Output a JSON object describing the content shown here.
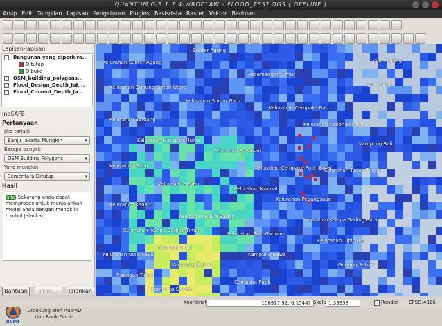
{
  "window": {
    "title": "QUANTUM GIS 1.7.4-WROCLAW - FLOOD_TEST.QGS ( OFFLINE )"
  },
  "menu": [
    "Arsip",
    "Edit",
    "Tampilan",
    "Lapisan",
    "Pengaturan",
    "Plugins",
    "Basisdata",
    "Raster",
    "Vektor",
    "Bantuan"
  ],
  "layers_panel": {
    "title": "Lapisan-lapisan",
    "layers": [
      {
        "name": "Bangunan yang diperkira..."
      },
      {
        "name": "Ditutup",
        "legend": true,
        "color": "#cc2222"
      },
      {
        "name": "Dibuka",
        "legend": true,
        "color": "#22aa22"
      },
      {
        "name": "OSM_building_polygons..."
      },
      {
        "name": "Flood_Design_Depth_Jak..."
      },
      {
        "name": "Flood_Current_Depth_Ja..."
      }
    ]
  },
  "inasafe": {
    "title": "InaSAFE",
    "question_title": "Pertanyaan",
    "label_hazard": "Jika terjadi",
    "hazard_value": "Banjir Jakarta Mungkin",
    "label_exposure": "Berapa banyak",
    "exposure_value": "OSM Building Polygons",
    "label_function": "Yang mungkin",
    "function_value": "Sementara Ditutup",
    "result_title": "Hasil",
    "result_badge": "Info",
    "result_text": "Sekarang anda dapat memproses untuk menjalankan model anda dengan mengklik tombol Jalankan.",
    "sponsor_text": "Didukung oleh AusAID dan Bank Dunia",
    "logo_text": "BNPB",
    "help_button": "Bantuan",
    "print_button": "Print...",
    "run_button": "Jalankan"
  },
  "map_labels": [
    "Sunter Agung",
    "Kelurahan Sunter Agung",
    "Pademangan Timur",
    "Kelurahan Gunung Sahari Utara",
    "Kelurahan Sumur Batu",
    "Kelurahan Cempaka Baru",
    "Kelurahan Serdang",
    "Kelurahan Kebon Kosong",
    "Kelurahan Harapan Mulya",
    "Kelurahan Rawasari",
    "Kelurahan Galur",
    "Kelurahan Cempaka Putih Barat",
    "Kelurahan Tanah Tinggi",
    "Kelurahan Senen",
    "Kelurahan Kramat",
    "Kelurahan Pegangsaan",
    "Kelurahan Kenari",
    "Kelurahan Rawa Badak",
    "Kelurahan Kelapa Gading Barat",
    "Kelurahan Kelapa Gading Timur",
    "Kelurahan Pulo Gadung",
    "Kelurahan Cipinang",
    "Kelurahan Jati",
    "Kelurahan Utan Kayu",
    "Kampung Rawa",
    "Kampung Dukuh",
    "Gunung Sahari",
    "Pisangan Timur",
    "Cempaka Putih",
    "Kampung Sawah",
    "Villa Gading",
    "Jati Sunter",
    "Kampung Bali"
  ],
  "status": {
    "coord_label": "Koordinat:",
    "coord_value": "106917 92,-6.15447",
    "scale_label": "Skala",
    "scale_value": "1:33958",
    "render_label": "Render",
    "epsg": "EPSG:4326"
  }
}
